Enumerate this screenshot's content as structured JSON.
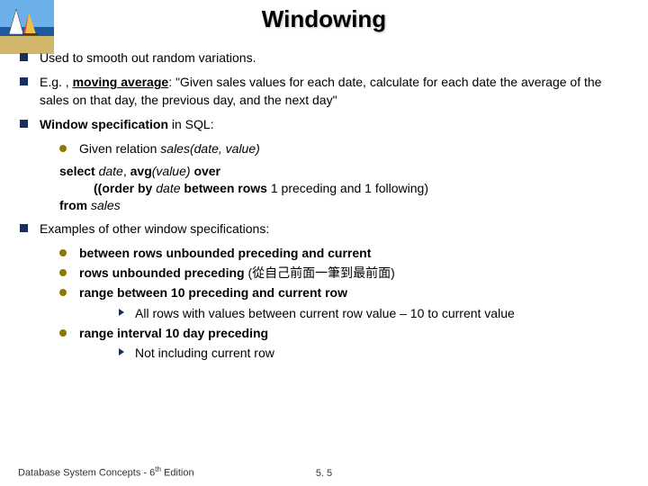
{
  "title": "Windowing",
  "bullets": {
    "b1": "Used to smooth out random variations.",
    "b2_pre": "E.g. , ",
    "b2_ma": "moving average",
    "b2_post": ": \"Given sales values for each date, calculate for each date the average of the sales on that day, the previous day, and the next day\"",
    "b3_pre": "Window specification",
    "b3_post": " in SQL:",
    "b3_s1_pre": "Given relation ",
    "b3_s1_ital": "sales(date, value)",
    "q_select": "select",
    "q_date": " date",
    "q_comma": ", ",
    "q_avg": "avg",
    "q_val": "(value) ",
    "q_over": "over",
    "q_ob1": "(order by",
    "q_dt2": " date ",
    "q_bw": "between rows",
    "q_tail": " 1 preceding and 1 following)",
    "q_from": "from",
    "q_sales": " sales",
    "b4": "Examples of other window specifications:",
    "b4_s1": "between rows unbounded preceding and current",
    "b4_s2_b": "rows unbounded preceding",
    "b4_s2_t": " (從自己前面一筆到最前面)",
    "b4_s3": "range  between 10 preceding and current row",
    "b4_s3_a": "All rows with values between current row value – 10 to current value",
    "b4_s4": "range interval 10 day preceding",
    "b4_s4_a": "Not including current row"
  },
  "footer": {
    "left_pre": "Database System Concepts - 6",
    "left_sup": "th",
    "left_post": " Edition",
    "center": "5. 5"
  }
}
